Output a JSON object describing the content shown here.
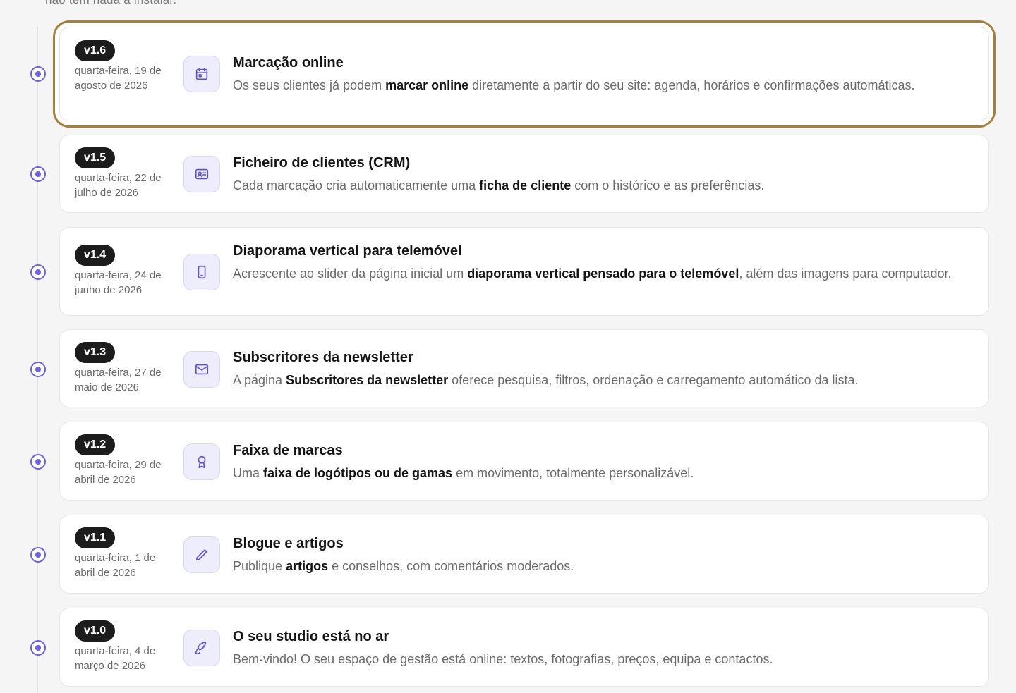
{
  "top_text": "não tem nada a instalar.",
  "entries": [
    {
      "version": "v1.6",
      "date": "quarta-feira, 19 de agosto de 2026",
      "title": "Marcação online",
      "desc_pre": "Os seus clientes já podem ",
      "desc_bold": "marcar online",
      "desc_post": " diretamente a partir do seu site: agenda, horários e confirmações automáticas.",
      "icon": "calendar-icon"
    },
    {
      "version": "v1.5",
      "date": "quarta-feira, 22 de julho de 2026",
      "title": "Ficheiro de clientes (CRM)",
      "desc_pre": "Cada marcação cria automaticamente uma ",
      "desc_bold": "ficha de cliente",
      "desc_post": " com o histórico e as preferências.",
      "icon": "contact-card-icon"
    },
    {
      "version": "v1.4",
      "date": "quarta-feira, 24 de junho de 2026",
      "title": "Diaporama vertical para telemóvel",
      "desc_pre": "Acrescente ao slider da página inicial um ",
      "desc_bold": "diaporama vertical pensado para o telemóvel",
      "desc_post": ", além das imagens para computador.",
      "icon": "smartphone-icon"
    },
    {
      "version": "v1.3",
      "date": "quarta-feira, 27 de maio de 2026",
      "title": "Subscritores da newsletter",
      "desc_pre": "A página ",
      "desc_bold": "Subscritores da newsletter",
      "desc_post": " oferece pesquisa, filtros, ordenação e carregamento automático da lista.",
      "icon": "mail-icon"
    },
    {
      "version": "v1.2",
      "date": "quarta-feira, 29 de abril de 2026",
      "title": "Faixa de marcas",
      "desc_pre": "Uma ",
      "desc_bold": "faixa de logótipos ou de gamas",
      "desc_post": " em movimento, totalmente personalizável.",
      "icon": "award-icon"
    },
    {
      "version": "v1.1",
      "date": "quarta-feira, 1 de abril de 2026",
      "title": "Blogue e artigos",
      "desc_pre": "Publique ",
      "desc_bold": "artigos",
      "desc_post": " e conselhos, com comentários moderados.",
      "icon": "pencil-icon"
    },
    {
      "version": "v1.0",
      "date": "quarta-feira, 4 de março de 2026",
      "title": "O seu studio está no ar",
      "desc_pre": "Bem-vindo! O seu espaço de gestão está online: textos, fotografias, preços, equipa e contactos.",
      "desc_bold": "",
      "desc_post": "",
      "icon": "rocket-icon"
    }
  ]
}
